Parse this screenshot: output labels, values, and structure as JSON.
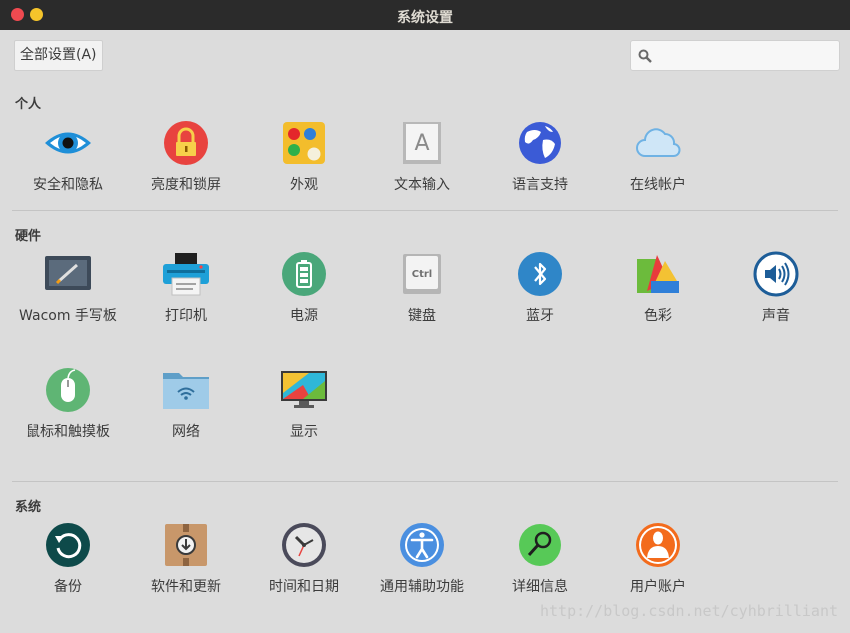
{
  "window": {
    "title": "系统设置"
  },
  "toolbar": {
    "all_settings_label": "全部设置(A)",
    "search_placeholder": ""
  },
  "sections": {
    "personal": {
      "title": "个人",
      "items": [
        {
          "label": "安全和隐私",
          "icon": "privacy-eye-icon"
        },
        {
          "label": "亮度和锁屏",
          "icon": "lock-icon"
        },
        {
          "label": "外观",
          "icon": "appearance-icon"
        },
        {
          "label": "文本输入",
          "icon": "text-entry-icon"
        },
        {
          "label": "语言支持",
          "icon": "globe-icon"
        },
        {
          "label": "在线帐户",
          "icon": "cloud-icon"
        }
      ]
    },
    "hardware": {
      "title": "硬件",
      "items": [
        {
          "label": "Wacom 手写板",
          "icon": "wacom-tablet-icon"
        },
        {
          "label": "打印机",
          "icon": "printer-icon"
        },
        {
          "label": "电源",
          "icon": "battery-icon"
        },
        {
          "label": "键盘",
          "icon": "keyboard-icon"
        },
        {
          "label": "蓝牙",
          "icon": "bluetooth-icon"
        },
        {
          "label": "色彩",
          "icon": "color-icon"
        },
        {
          "label": "声音",
          "icon": "sound-icon"
        },
        {
          "label": "鼠标和触摸板",
          "icon": "mouse-icon"
        },
        {
          "label": "网络",
          "icon": "network-folder-icon"
        },
        {
          "label": "显示",
          "icon": "display-icon"
        }
      ]
    },
    "system": {
      "title": "系统",
      "items": [
        {
          "label": "备份",
          "icon": "backup-icon"
        },
        {
          "label": "软件和更新",
          "icon": "software-updates-icon"
        },
        {
          "label": "时间和日期",
          "icon": "clock-icon"
        },
        {
          "label": "通用辅助功能",
          "icon": "accessibility-icon"
        },
        {
          "label": "详细信息",
          "icon": "details-icon"
        },
        {
          "label": "用户账户",
          "icon": "user-accounts-icon"
        }
      ]
    }
  },
  "watermark": "http://blog.csdn.net/cyhbrilliant",
  "colors": {
    "titlebar": "#2b2b2b",
    "background": "#dcdcdc",
    "close": "#f04a50",
    "minimize": "#f5c42b"
  }
}
